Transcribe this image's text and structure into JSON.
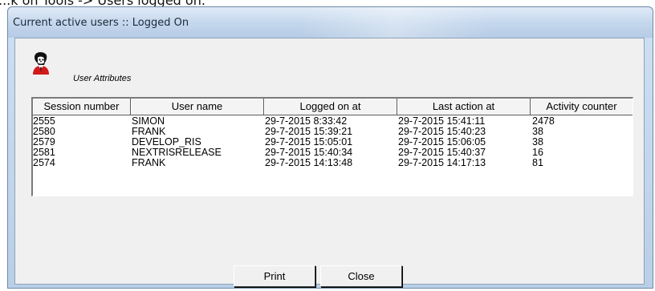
{
  "caption": "...k on Tools -> Users logged on.",
  "window": {
    "title": "Current active users :: Logged On"
  },
  "icons": {
    "user_icon": "user-attributes-icon"
  },
  "group_label": "User Attributes",
  "table": {
    "columns": [
      "Session number",
      "User name",
      "Logged on at",
      "Last action at",
      "Activity counter"
    ],
    "rows": [
      [
        "2555",
        "SIMON",
        "29-7-2015 8:33:42",
        "29-7-2015 15:41:11",
        "2478"
      ],
      [
        "2580",
        "FRANK",
        "29-7-2015 15:39:21",
        "29-7-2015 15:40:23",
        "38"
      ],
      [
        "2579",
        "DEVELOP_RIS",
        "29-7-2015 15:05:01",
        "29-7-2015 15:06:05",
        "38"
      ],
      [
        "2581",
        "NEXTRISRELEASE",
        "29-7-2015 15:40:34",
        "29-7-2015 15:40:37",
        "16"
      ],
      [
        "2574",
        "FRANK",
        "29-7-2015 14:13:48",
        "29-7-2015 14:17:13",
        "81"
      ]
    ]
  },
  "buttons": {
    "print_label": "Print",
    "close_label": "Close"
  }
}
